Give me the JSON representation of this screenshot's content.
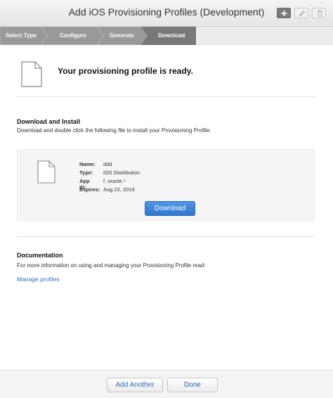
{
  "window": {
    "title": "Add iOS Provisioning Profiles (Development)"
  },
  "steps": [
    {
      "label": "Select Type"
    },
    {
      "label": "Configure"
    },
    {
      "label": "Generate"
    },
    {
      "label": "Download"
    }
  ],
  "header": {
    "status": "Your provisioning profile is ready."
  },
  "download_section": {
    "heading": "Download and Install",
    "description": "Download and double click the following file to install your Provisioning Profile.",
    "profile": {
      "name_label": "Name:",
      "name_value": "ddd",
      "type_label": "Type:",
      "type_value": "iOS Distribution",
      "app_id_label": "App ID:",
      "app_id_value": "f                    .oracle.*",
      "expires_label": "Expires:",
      "expires_value": "Aug 22, 2019"
    },
    "button_label": "Download"
  },
  "documentation": {
    "heading": "Documentation",
    "description": "For more information on using and managing your Provisioning Profile read:",
    "link_label": "Manage profiles"
  },
  "footer": {
    "add_another_label": "Add Another",
    "done_label": "Done"
  },
  "icons": [
    "plus-icon",
    "pencil-icon",
    "trash-icon",
    "document-icon"
  ],
  "colors": {
    "active_step": "#999999",
    "inactive_step": "#787878",
    "link": "#2d6fc2",
    "button_primary": "#3a84d8"
  }
}
